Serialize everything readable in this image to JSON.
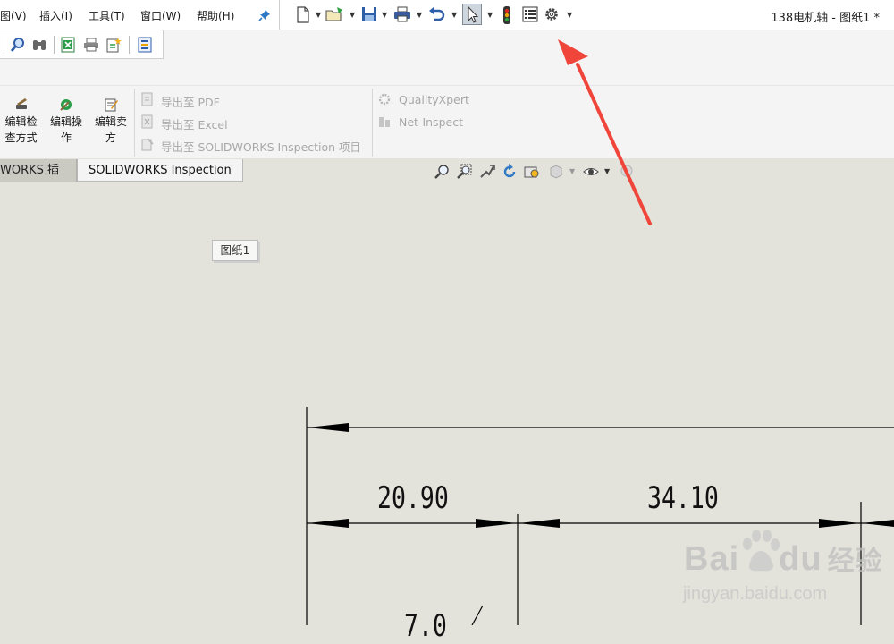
{
  "menus": [
    "图(V)",
    "插入(I)",
    "工具(T)",
    "窗口(W)",
    "帮助(H)"
  ],
  "document_title": "138电机轴 - 图纸1 *",
  "ribbon": {
    "edit_inspection_method": [
      "编辑检",
      "查方式"
    ],
    "edit_operation": [
      "编辑操",
      "作"
    ],
    "edit_vendor": [
      "编辑卖",
      "方"
    ],
    "export_pdf": "导出至 PDF",
    "export_excel": "导出至 Excel",
    "export_project": "导出至 SOLIDWORKS Inspection 项目",
    "quality_xpert": "QualityXpert",
    "net_inspect": "Net-Inspect"
  },
  "tabs": [
    "WORKS 插件",
    "SOLIDWORKS Inspection"
  ],
  "active_tab": "SOLIDWORKS Inspection",
  "sheet_label": "图纸1",
  "dimensions": [
    "20.90",
    "34.10",
    "7.0"
  ],
  "watermark": {
    "brand": "Bai",
    "brand_suffix": "du",
    "service": "经验",
    "url": "jingyan.baidu.com"
  },
  "colors": {
    "annotation_arrow": "#f0453a",
    "canvas": "#e4e3db",
    "traffic_red": "#d62a1e",
    "traffic_yellow": "#e8a400",
    "traffic_green": "#2aa13b"
  }
}
